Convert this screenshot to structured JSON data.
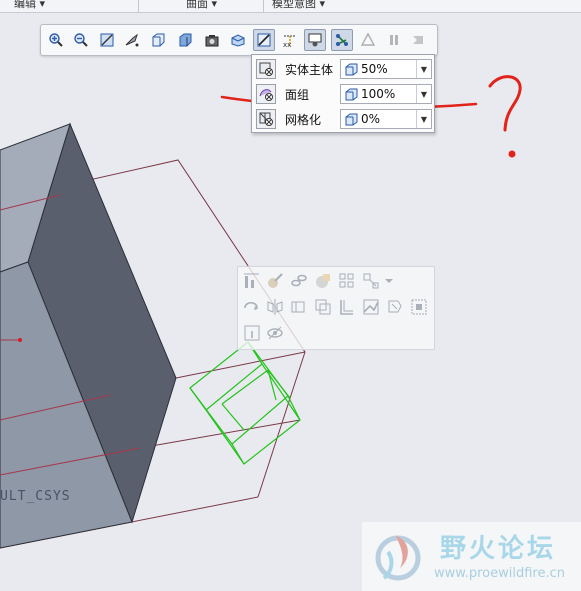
{
  "ribbon": {
    "groups": [
      "编辑 ▾",
      "曲面 ▾",
      "模型意图 ▾"
    ]
  },
  "graphics_toolbar": {
    "buttons": [
      "zoom-in-icon",
      "zoom-out-icon",
      "refit-icon",
      "reorient-icon",
      "saved-views-icon",
      "display-style-icon",
      "perspective-view-icon",
      "section-icon",
      "transparency-icon",
      "datum-display-icon",
      "spin-center-icon",
      "view-manager-icon",
      "annotation-display-icon",
      "pause-icon",
      "next-icon"
    ]
  },
  "transparency_dropdown": {
    "rows": [
      {
        "label": "实体主体",
        "value": "50%"
      },
      {
        "label": "面组",
        "value": "100%"
      },
      {
        "label": "网格化",
        "value": "0%"
      }
    ]
  },
  "annotation": {
    "question_mark": "?"
  },
  "model": {
    "csys_label": "ULT_CSYS"
  },
  "watermark": {
    "title": "野火论坛",
    "url": "www.proewildfire.cn"
  },
  "colors": {
    "background": "#e8eaf0",
    "model_light": "#9aa3b1",
    "model_dark": "#5c6170",
    "wire_green": "#22c41a",
    "annotation_red": "#e2231a"
  }
}
